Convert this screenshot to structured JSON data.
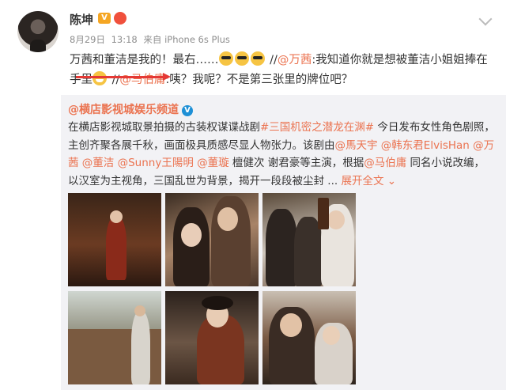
{
  "user": {
    "name": "陈坤"
  },
  "meta": {
    "date": "8月29日",
    "time": "13:18",
    "source": "来自 iPhone 6s Plus"
  },
  "post": {
    "part1": "万茜和董洁是我的！最右……",
    "part2": " //",
    "mention1": "@万茜",
    "part3": ":我知道你就是想被董洁小姐姐捧在手里",
    "part4": " //",
    "mention2": "@马伯庸",
    "part5": ":咦？我呢？不是第三张里的牌位吧？"
  },
  "repost": {
    "account": "@横店影视城娱乐频道",
    "t1": "在横店影视城取景拍摄的古装权谋谍战剧",
    "tag": "#三国机密之潜龙在渊#",
    "t2": " 今日发布女性角色剧照，主创齐聚各展千秋，画面极具质感尽显人物张力。该剧由",
    "m1": "@馬天宇",
    "m2": "@韩东君ElvisHan",
    "m3": "@万茜",
    "m4": "@董洁",
    "m5": "@Sunny王陽明",
    "m6": "@董璇",
    "t3": " 檀健次 谢君豪等主演，根据",
    "m7": "@马伯庸",
    "t4": " 同名小说改编，以汉室为主视角，三国乱世为背景，揭开一段段被尘封 ...",
    "expand": "展开全文 ⌄"
  },
  "icons": [
    "avatar",
    "vip-badge",
    "verified-badge",
    "sunglasses-emoji",
    "grin-emoji",
    "chevron-down-icon"
  ],
  "colors": {
    "mention": "#eb7350",
    "annotation": "#e53935",
    "repost_bg": "#f2f2f5"
  }
}
